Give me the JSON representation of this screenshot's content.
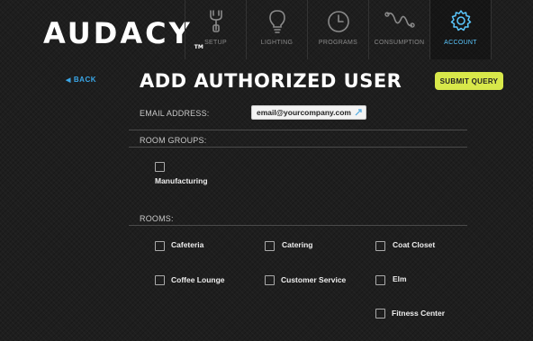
{
  "app": {
    "logo_text": "AUDACY",
    "logo_tm": "TM"
  },
  "nav": {
    "items": [
      {
        "label": "SETUP",
        "icon": "wrench-icon"
      },
      {
        "label": "LIGHTING",
        "icon": "lightbulb-icon"
      },
      {
        "label": "PROGRAMS",
        "icon": "clock-icon"
      },
      {
        "label": "CONSUMPTION",
        "icon": "wave-chart-icon"
      },
      {
        "label": "ACCOUNT",
        "icon": "gear-icon",
        "active": true
      }
    ],
    "active_color": "#5bc8ff"
  },
  "back_label": "BACK",
  "page_title": "ADD AUTHORIZED USER",
  "submit_label": "SUBMIT QUERY",
  "submit_color": "#d8e84a",
  "form": {
    "email_label": "EMAIL ADDRESS:",
    "email_value": "email@yourcompany.com",
    "room_groups_label": "ROOM GROUPS:",
    "room_groups": [
      "Manufacturing"
    ],
    "rooms_label": "ROOMS:",
    "rooms": [
      "Cafeteria",
      "Catering",
      "Coat Closet",
      "Coffee Lounge",
      "Customer Service",
      "Elm",
      "Fitness Center"
    ]
  }
}
